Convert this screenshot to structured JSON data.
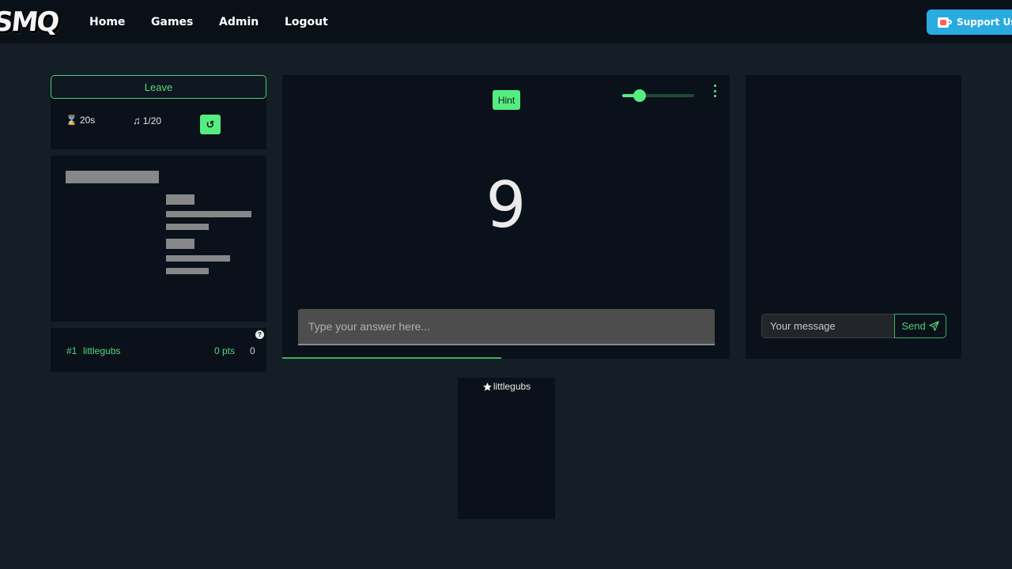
{
  "header": {
    "logo": "SMQ",
    "nav": [
      {
        "label": "Home"
      },
      {
        "label": "Games"
      },
      {
        "label": "Admin"
      },
      {
        "label": "Logout"
      }
    ],
    "support_label": "Support Us!",
    "support_color": "#29abe0"
  },
  "game_controls": {
    "leave_label": "Leave",
    "timer_icon": "hourglass-icon",
    "timer_value": "20s",
    "song_icon": "music-note-icon",
    "song_progress": "1/20",
    "refresh_icon": "refresh-icon"
  },
  "scoreboard": {
    "help_label": "?",
    "entries": [
      {
        "rank": "#1",
        "name": "littlegubs",
        "points": "0 pts",
        "extra": "0"
      }
    ]
  },
  "player_area": {
    "hint_label": "Hint",
    "volume_percent": 24,
    "countdown": "9",
    "answer_placeholder": "Type your answer here...",
    "round_progress_percent": 49
  },
  "chat": {
    "message_placeholder": "Your message",
    "send_label": "Send"
  },
  "players": [
    {
      "name": "littlegubs",
      "icon": "star-icon"
    }
  ],
  "colors": {
    "accent": "#55ec80",
    "accent_text": "#5ad47d",
    "background": "#151d27",
    "panel": "#0a111a"
  }
}
